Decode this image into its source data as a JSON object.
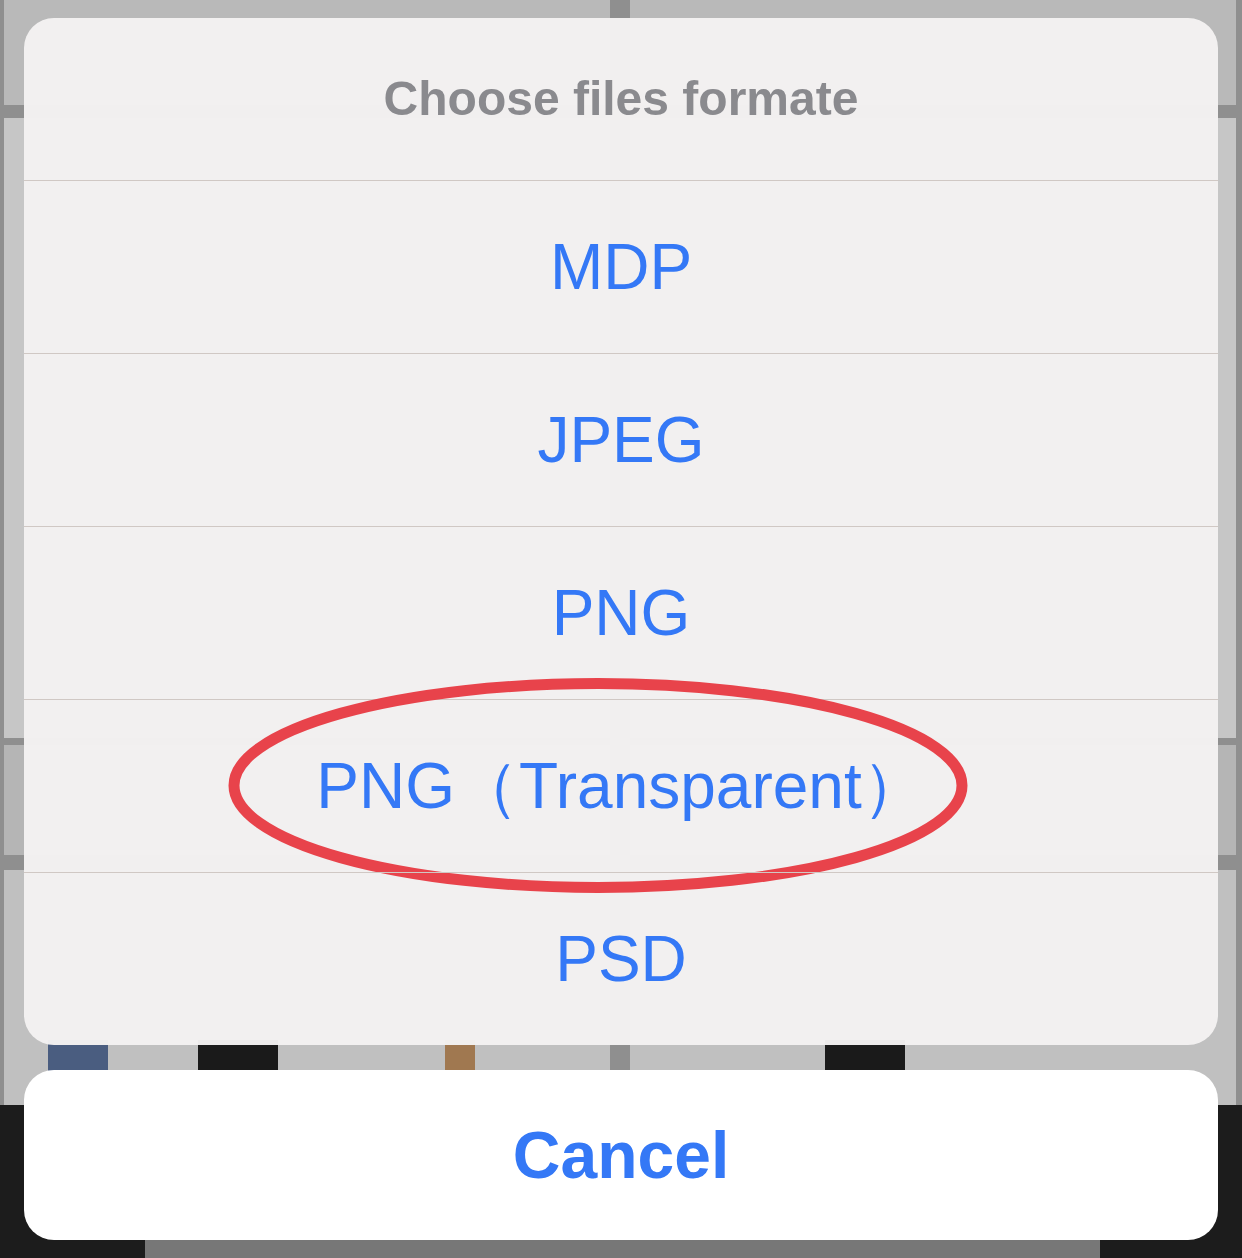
{
  "action_sheet": {
    "title": "Choose files formate",
    "options": [
      {
        "label": "MDP",
        "circled": false
      },
      {
        "label": "JPEG",
        "circled": false
      },
      {
        "label": "PNG",
        "circled": false
      },
      {
        "label": "PNG（Transparent）",
        "circled": true
      },
      {
        "label": "PSD",
        "circled": false
      }
    ]
  },
  "cancel_button": {
    "label": "Cancel"
  }
}
